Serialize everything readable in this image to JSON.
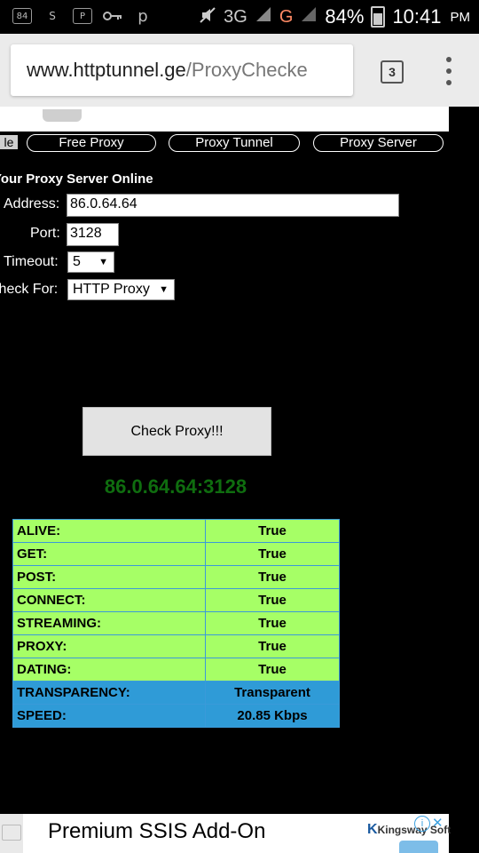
{
  "status_bar": {
    "left_icons": [
      "84",
      "S",
      "P",
      "key",
      "p"
    ],
    "network": "3G",
    "carrier_g": "G",
    "battery": "84%",
    "battery_level": 0.84,
    "time": "10:41",
    "ampm": "PM"
  },
  "browser": {
    "url_domain": "www.httptunnel.ge",
    "url_path": "/ProxyChecke",
    "tabs_count": "3"
  },
  "nav": {
    "stub": "le",
    "items": [
      "Free Proxy",
      "Proxy Tunnel",
      "Proxy Server"
    ]
  },
  "form": {
    "title": "Your Proxy Server Online",
    "address_label": "Address:",
    "address_value": "86.0.64.64",
    "port_label": "Port:",
    "port_value": "3128",
    "timeout_label": "Timeout:",
    "timeout_value": "5",
    "check_for_label": "Check For:",
    "check_for_value": "HTTP Proxy",
    "button_label": "Check Proxy!!!"
  },
  "result": {
    "address": "86.0.64.64:3128",
    "rows": [
      {
        "label": "ALIVE:",
        "value": "True",
        "color": "#a6ff66"
      },
      {
        "label": "GET:",
        "value": "True",
        "color": "#a6ff66"
      },
      {
        "label": "POST:",
        "value": "True",
        "color": "#a6ff66"
      },
      {
        "label": "CONNECT:",
        "value": "True",
        "color": "#a6ff66"
      },
      {
        "label": "STREAMING:",
        "value": "True",
        "color": "#a6ff66"
      },
      {
        "label": "PROXY:",
        "value": "True",
        "color": "#a6ff66"
      },
      {
        "label": "DATING:",
        "value": "True",
        "color": "#a6ff66"
      },
      {
        "label": "TRANSPARENCY:",
        "value": "Transparent",
        "color": "#2f9bd7"
      },
      {
        "label": "SPEED:",
        "value": "20.85 Kbps",
        "color": "#2f9bd7"
      }
    ]
  },
  "ad": {
    "title": "Premium SSIS Add-On",
    "logo": "Kingsway Soft",
    "info_icon": "i",
    "close_icon": "✕"
  }
}
